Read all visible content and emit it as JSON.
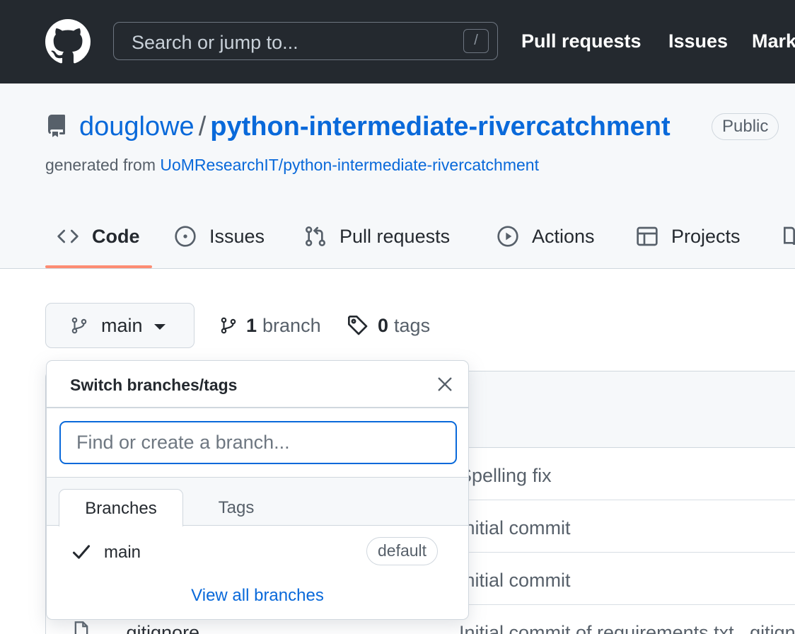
{
  "header": {
    "search_placeholder": "Search or jump to...",
    "search_shortcut": "/",
    "nav": [
      "Pull requests",
      "Issues",
      "Marketplace"
    ]
  },
  "repo": {
    "owner": "douglowe",
    "separator": "/",
    "name": "python-intermediate-rivercatchment",
    "visibility": "Public",
    "generated_prefix": "generated from",
    "generated_from": "UoMResearchIT/python-intermediate-rivercatchment"
  },
  "tabs": [
    {
      "label": "Code",
      "icon": "code-icon",
      "active": true
    },
    {
      "label": "Issues",
      "icon": "issue-opened-icon"
    },
    {
      "label": "Pull requests",
      "icon": "git-pull-request-icon"
    },
    {
      "label": "Actions",
      "icon": "play-icon"
    },
    {
      "label": "Projects",
      "icon": "table-icon"
    }
  ],
  "branch_bar": {
    "current_branch": "main",
    "branch_count": "1",
    "branch_label": "branch",
    "tag_count": "0",
    "tag_label": "tags"
  },
  "files": [
    {
      "name": "",
      "commit": "Spelling fix"
    },
    {
      "name": "",
      "commit": "Initial commit"
    },
    {
      "name": "",
      "commit": "Initial commit"
    },
    {
      "name": ".gitignore",
      "commit": "Initial commit of requirements.txt, .gitignore"
    }
  ],
  "dropdown": {
    "title": "Switch branches/tags",
    "filter_placeholder": "Find or create a branch...",
    "tabs": [
      "Branches",
      "Tags"
    ],
    "branches": [
      {
        "name": "main",
        "selected": true,
        "badge": "default"
      }
    ],
    "view_all": "View all branches"
  },
  "colors": {
    "header_bg": "#24292f",
    "link": "#0969da",
    "tab_underline": "#fd8c73",
    "border": "#d0d7de"
  }
}
